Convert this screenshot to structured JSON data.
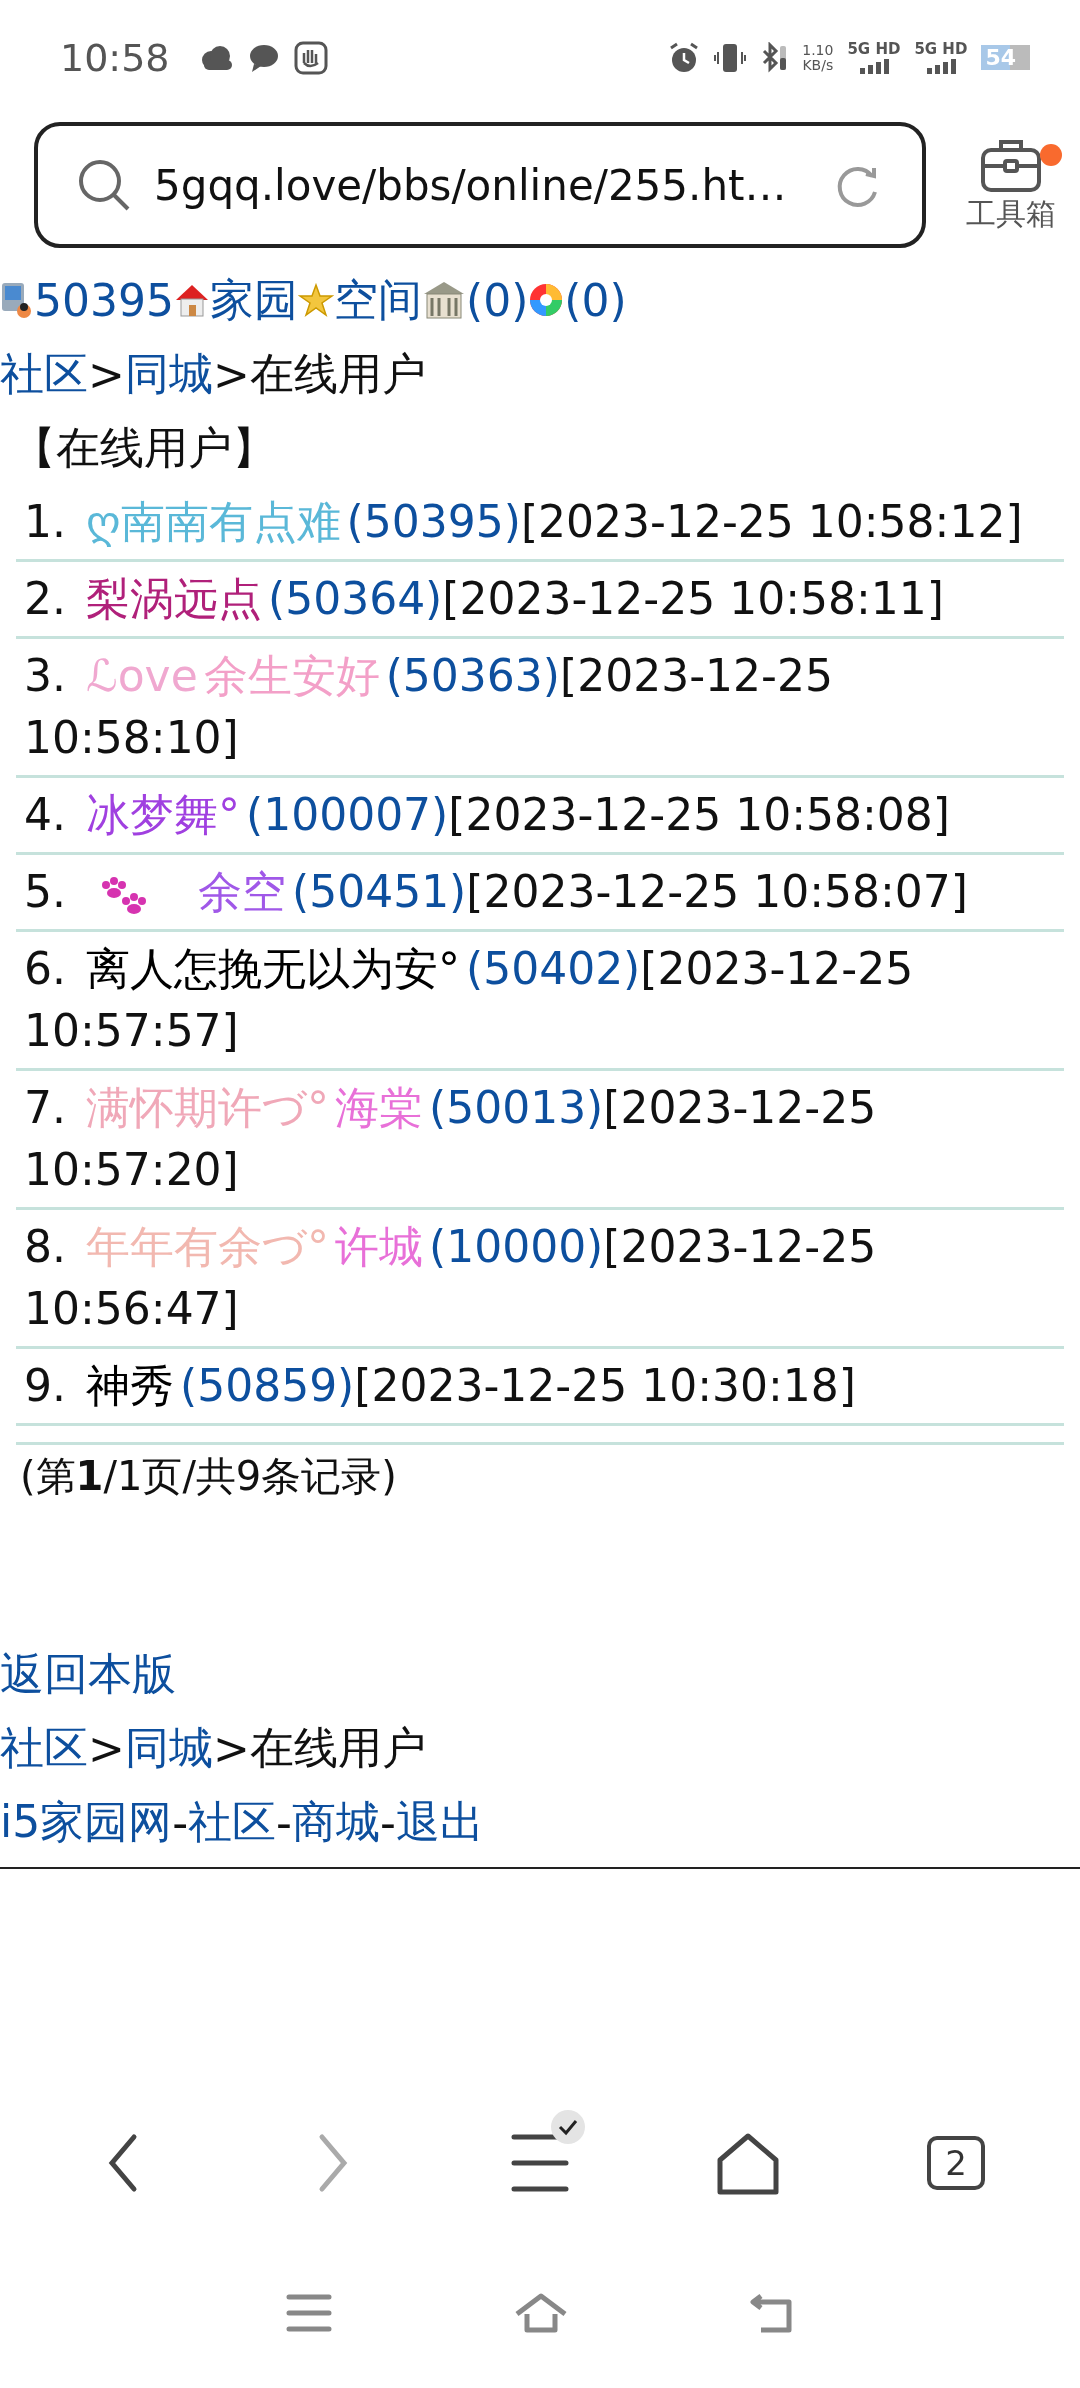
{
  "status_bar": {
    "time": "10:58",
    "net_speed": "1.10",
    "net_unit": "KB/s",
    "sim_1": "5G HD",
    "sim_2": "5G HD",
    "battery": "54"
  },
  "address_bar": {
    "url": "5gqq.love/bbs/online/255.ht…",
    "toolbox_label": "工具箱",
    "toolbox_notification": true
  },
  "user_bar": [
    {
      "kind": "user",
      "text": "50395"
    },
    {
      "kind": "home",
      "text": "家园"
    },
    {
      "kind": "space",
      "text": "空间"
    },
    {
      "kind": "building",
      "text": "(0)"
    },
    {
      "kind": "pinwheel",
      "text": "(0)"
    }
  ],
  "breadcrumb": [
    {
      "text": "社区",
      "link": true
    },
    {
      "text": ">",
      "link": false
    },
    {
      "text": "同城",
      "link": true
    },
    {
      "text": ">",
      "link": false
    },
    {
      "text": "在线用户",
      "link": false
    }
  ],
  "heading": "【在线用户】",
  "users": [
    {
      "index": "1.",
      "kind": "plain",
      "name": [
        {
          "text": "ღ南南有点难",
          "color": "#5ab8d8"
        }
      ],
      "id": "(50395)",
      "date": "[2023-12-25",
      "time": "10:58:12]"
    },
    {
      "index": "2.",
      "kind": "plain",
      "name": [
        {
          "text": "梨涡远点",
          "color": "#b0207a"
        }
      ],
      "id": "(50364)",
      "date": "[2023-12-25",
      "time": "10:58:11]"
    },
    {
      "index": "3.",
      "kind": "plain",
      "name": [
        {
          "text": "ℒove",
          "color": "#f0a8d0"
        },
        {
          "text": "余生安好",
          "color": "#f3a0c8"
        }
      ],
      "id": "(50363)",
      "date": "[2023-12-25",
      "time": "10:58:10]"
    },
    {
      "index": "4.",
      "kind": "plain",
      "name": [
        {
          "text": "冰梦舞°",
          "color": "#a040e0"
        }
      ],
      "id": "(100007)",
      "date": "[2023-12-25",
      "time": "10:58:08]"
    },
    {
      "index": "5.",
      "kind": "paw",
      "name": [
        {
          "text": "余空",
          "color": "#a058e8"
        }
      ],
      "id": "(50451)",
      "date": "[2023-12-25",
      "time": "10:58:07]"
    },
    {
      "index": "6.",
      "kind": "plain",
      "name": [
        {
          "text": "离人怎挽无以为安°",
          "color": "#000000"
        }
      ],
      "id": "(50402)",
      "date": "[2023-12-25",
      "time": "10:57:57]"
    },
    {
      "index": "7.",
      "kind": "plain",
      "name": [
        {
          "text": "满怀期许づ°",
          "color": "#f0a8b8"
        },
        {
          "text": "海棠",
          "color": "#e870d8"
        }
      ],
      "id": "(50013)",
      "date": "[2023-12-25",
      "time": "10:57:20]"
    },
    {
      "index": "8.",
      "kind": "plain",
      "name": [
        {
          "text": "年年有余づ°",
          "color": "#f2b8b0"
        },
        {
          "text": "许城",
          "color": "#e870d8"
        }
      ],
      "id": "(10000)",
      "date": "[2023-12-25",
      "time": "10:56:47]"
    },
    {
      "index": "9.",
      "kind": "plain",
      "name": [
        {
          "text": "神秀",
          "color": "#000000"
        }
      ],
      "id": "(50859)",
      "date": "[2023-12-25",
      "time": "10:30:18]"
    }
  ],
  "pagination": "(第**1**/1页/共9条记录)",
  "back_link": "返回本版",
  "footer_breadcrumb": [
    {
      "text": "社区",
      "link": true
    },
    {
      "text": ">",
      "link": false
    },
    {
      "text": "同城",
      "link": true
    },
    {
      "text": ">",
      "link": false
    },
    {
      "text": "在线用户",
      "link": false
    }
  ],
  "footer_links": [
    {
      "text": "i5家园网",
      "link": true
    },
    {
      "text": "-",
      "link": false
    },
    {
      "text": "社区",
      "link": true
    },
    {
      "text": "-",
      "link": false
    },
    {
      "text": "商城",
      "link": true
    },
    {
      "text": "-",
      "link": false
    },
    {
      "text": "退出",
      "link": true
    }
  ],
  "browser_nav": {
    "back_disabled": false,
    "forward_disabled": true,
    "menu_badge": true,
    "tab_count": "2"
  }
}
